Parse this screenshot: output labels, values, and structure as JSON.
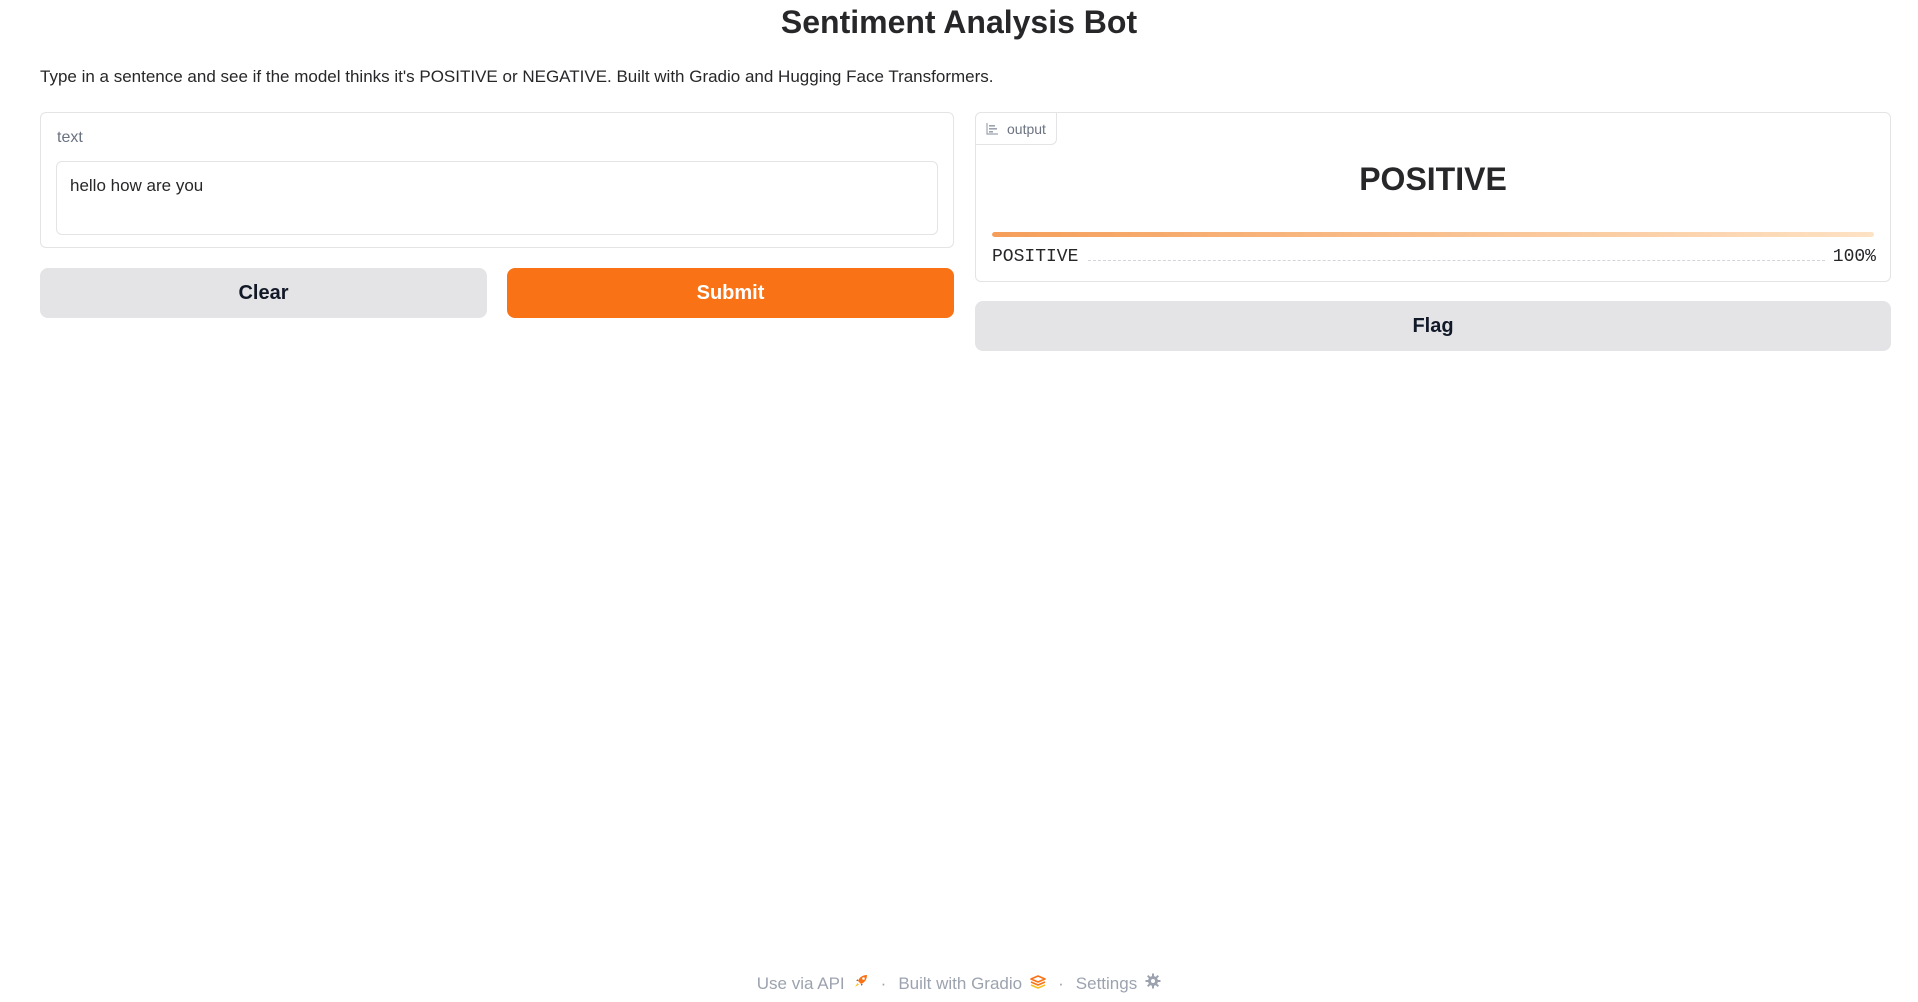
{
  "header": {
    "title": "Sentiment Analysis Bot",
    "description": "Type in a sentence and see if the model thinks it's POSITIVE or NEGATIVE. Built with Gradio and Hugging Face Transformers."
  },
  "input": {
    "label": "text",
    "value": "hello how are you"
  },
  "buttons": {
    "clear_label": "Clear",
    "submit_label": "Submit",
    "flag_label": "Flag"
  },
  "output": {
    "tag_label": "output",
    "tag_icon": "bar-chart-icon",
    "predicted_label": "POSITIVE",
    "confidences": [
      {
        "label": "POSITIVE",
        "value_text": "100%",
        "fraction": 1.0
      }
    ]
  },
  "footer": {
    "api_label": "Use via API",
    "api_icon": "rocket-icon",
    "built_label": "Built with Gradio",
    "built_icon": "gradio-logo-icon",
    "settings_label": "Settings",
    "settings_icon": "gear-icon",
    "separator": "·"
  },
  "colors": {
    "primary": "#f97316",
    "secondary": "#e4e4e7",
    "accent_gradient_start": "#f59e5a",
    "accent_gradient_end": "#fde2c4"
  }
}
